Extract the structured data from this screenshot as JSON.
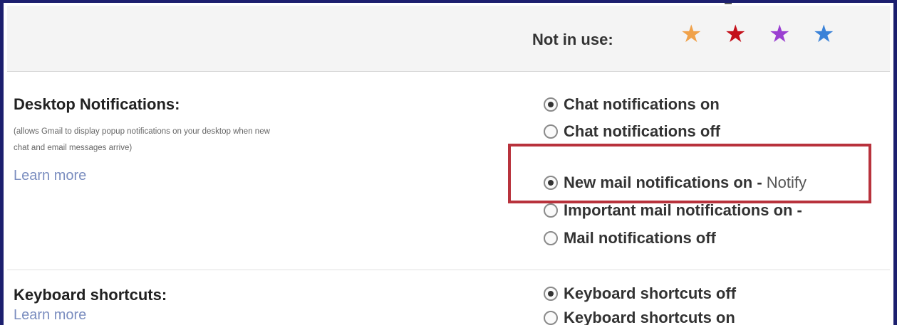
{
  "colors": {
    "frame_border": "#1c1f6e",
    "highlight_border": "#b8323c",
    "link": "#7a8dbf",
    "star_orange": "#f0a24b",
    "star_red": "#c4101a",
    "star_purple": "#9a3fd1",
    "star_blue": "#3a82d8"
  },
  "stars_section": {
    "label": "Not in use:",
    "stars": [
      {
        "icon": "orange-star-icon",
        "glyph": "★"
      },
      {
        "icon": "red-star-icon",
        "glyph": "★"
      },
      {
        "icon": "purple-star-icon",
        "glyph": "★"
      },
      {
        "icon": "blue-star-icon",
        "glyph": "★"
      }
    ]
  },
  "desktop_notifications": {
    "label": "Desktop Notifications:",
    "description_line1": "(allows Gmail to display popup notifications on your desktop when new",
    "description_line2": "chat and email messages arrive)",
    "learn_more": "Learn more",
    "chat_options": [
      {
        "label": "Chat notifications on",
        "checked": true
      },
      {
        "label": "Chat notifications off",
        "checked": false
      }
    ],
    "mail_options": [
      {
        "label": "New mail notifications on - ",
        "suffix": "Notify",
        "checked": true
      },
      {
        "label": "Important mail notifications on - ",
        "checked": false
      },
      {
        "label": "Mail notifications off",
        "checked": false
      }
    ]
  },
  "keyboard_shortcuts": {
    "label": "Keyboard shortcuts:",
    "learn_more": "Learn more",
    "options": [
      {
        "label": "Keyboard shortcuts off",
        "checked": true
      },
      {
        "label": "Keyboard shortcuts on",
        "checked": false
      }
    ]
  }
}
